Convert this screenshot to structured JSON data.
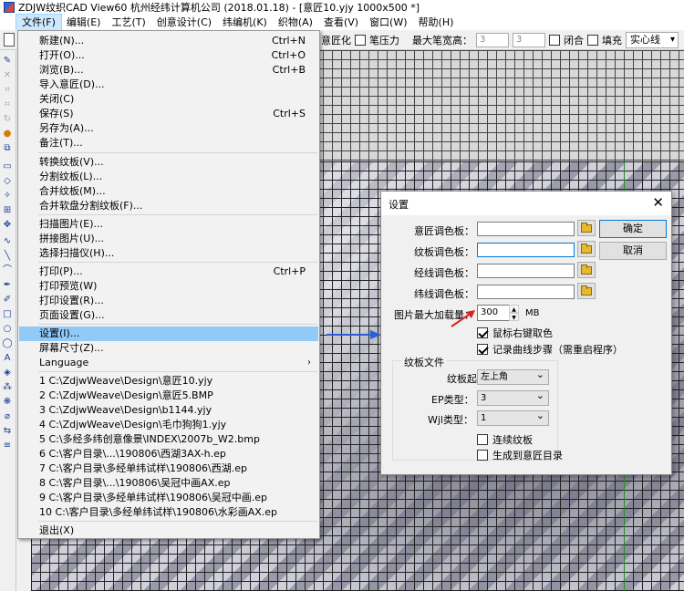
{
  "window": {
    "title": "ZDJW纹织CAD View60 杭州经纬计算机公司 (2018.01.18) - [意匠10.yjy 1000x500 *]"
  },
  "menubar": [
    {
      "label": "文件(F)"
    },
    {
      "label": "编辑(E)"
    },
    {
      "label": "工艺(T)"
    },
    {
      "label": "创意设计(C)"
    },
    {
      "label": "纬编机(K)"
    },
    {
      "label": "织物(A)"
    },
    {
      "label": "查看(V)"
    },
    {
      "label": "窗口(W)"
    },
    {
      "label": "帮助(H)"
    }
  ],
  "toolbar": {
    "pen_label": "意匠化",
    "pressure_label": "笔压力",
    "max_width_label": "最大笔宽高：",
    "width_value": "3",
    "height_value": "3",
    "close_label": "闭合",
    "fill_label": "填充",
    "line_style": "实心线"
  },
  "file_menu": {
    "items": [
      {
        "label": "新建(N)...",
        "shortcut": "Ctrl+N"
      },
      {
        "label": "打开(O)...",
        "shortcut": "Ctrl+O"
      },
      {
        "label": "浏览(B)...",
        "shortcut": "Ctrl+B"
      },
      {
        "label": "导入意匠(D)...",
        "shortcut": ""
      },
      {
        "label": "关闭(C)",
        "shortcut": ""
      },
      {
        "label": "保存(S)",
        "shortcut": "Ctrl+S"
      },
      {
        "label": "另存为(A)...",
        "shortcut": ""
      },
      {
        "label": "备注(T)...",
        "shortcut": ""
      },
      {
        "label": "转换纹板(V)...",
        "shortcut": ""
      },
      {
        "label": "分割纹板(L)...",
        "shortcut": ""
      },
      {
        "label": "合并纹板(M)...",
        "shortcut": ""
      },
      {
        "label": "合并软盘分割纹板(F)...",
        "shortcut": ""
      },
      {
        "label": "扫描图片(E)...",
        "shortcut": ""
      },
      {
        "label": "拼接图片(U)...",
        "shortcut": ""
      },
      {
        "label": "选择扫描仪(H)...",
        "shortcut": ""
      },
      {
        "label": "打印(P)...",
        "shortcut": "Ctrl+P"
      },
      {
        "label": "打印预览(W)",
        "shortcut": ""
      },
      {
        "label": "打印设置(R)...",
        "shortcut": ""
      },
      {
        "label": "页面设置(G)...",
        "shortcut": ""
      },
      {
        "label": "设置(I)...",
        "shortcut": ""
      },
      {
        "label": "屏幕尺寸(Z)...",
        "shortcut": ""
      },
      {
        "label": "Language",
        "shortcut": ""
      },
      {
        "label": "1 C:\\ZdjwWeave\\Design\\意匠10.yjy",
        "shortcut": ""
      },
      {
        "label": "2 C:\\ZdjwWeave\\Design\\意匠5.BMP",
        "shortcut": ""
      },
      {
        "label": "3 C:\\ZdjwWeave\\Design\\b1144.yjy",
        "shortcut": ""
      },
      {
        "label": "4 C:\\ZdjwWeave\\Design\\毛巾狗狗1.yjy",
        "shortcut": ""
      },
      {
        "label": "5 C:\\多经多纬创意像景\\INDEX\\2007b_W2.bmp",
        "shortcut": ""
      },
      {
        "label": "6 C:\\客户目录\\...\\190806\\西湖3AX-h.ep",
        "shortcut": ""
      },
      {
        "label": "7 C:\\客户目录\\多经单纬试样\\190806\\西湖.ep",
        "shortcut": ""
      },
      {
        "label": "8 C:\\客户目录\\...\\190806\\吴冠中画AX.ep",
        "shortcut": ""
      },
      {
        "label": "9 C:\\客户目录\\多经单纬试样\\190806\\吴冠中画.ep",
        "shortcut": ""
      },
      {
        "label": "10 C:\\客户目录\\多经单纬试样\\190806\\水彩画AX.ep",
        "shortcut": ""
      },
      {
        "label": "退出(X)",
        "shortcut": ""
      }
    ]
  },
  "settings_dialog": {
    "title": "设置",
    "close_glyph": "✕",
    "labels": {
      "design_palette": "意匠调色板：",
      "card_palette": "纹板调色板：",
      "warp_palette": "经线调色板：",
      "weft_palette": "纬线调色板：",
      "max_image_load": "图片最大加载量：",
      "unit": "MB"
    },
    "max_image_value": "300",
    "ok_label": "确定",
    "cancel_label": "取消",
    "checkbox_right_pick": "鼠标右键取色",
    "checkbox_record_curve": "记录曲线步骤（需重启程序）",
    "group_title": "纹板文件",
    "card_origin_label": "纹板起点：",
    "card_origin_value": "左上角",
    "ep_type_label": "EP类型：",
    "ep_type_value": "3",
    "wjl_type_label": "Wjl类型：",
    "wjl_type_value": "1",
    "checkbox_continuous": "连续纹板",
    "checkbox_generate": "生成到意匠目录"
  },
  "colors": {
    "highlight": "#91c9f7",
    "menu_active": "#cce8ff",
    "arrow_blue": "#2a5fd6",
    "arrow_red": "#e02020"
  }
}
